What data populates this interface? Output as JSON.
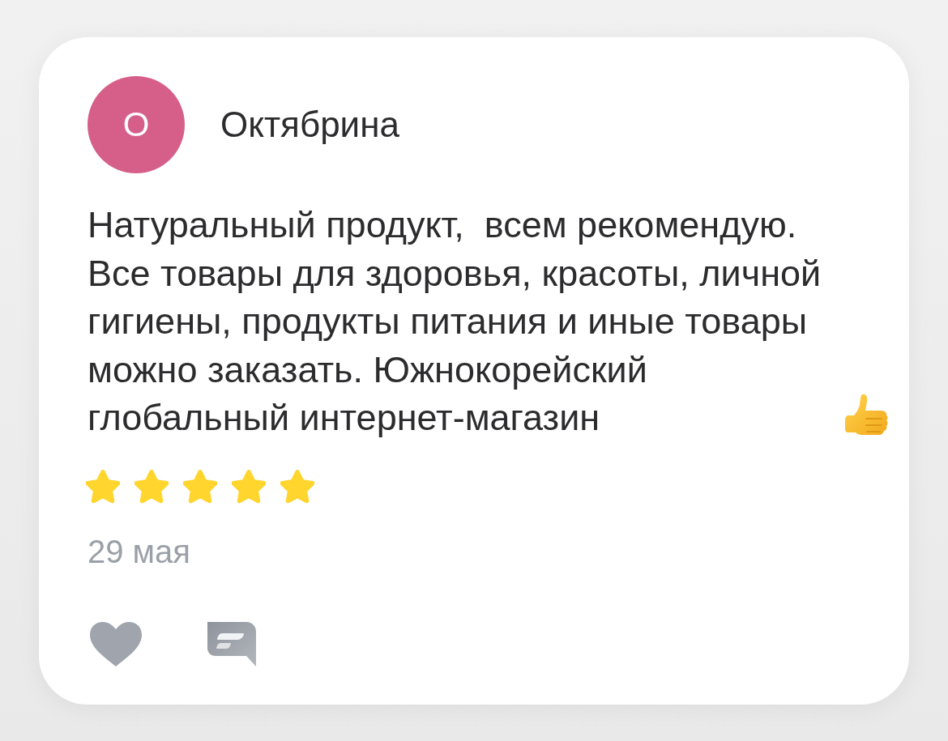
{
  "review": {
    "avatar_initial": "О",
    "author": "Октябрина",
    "text": "Натуральный продукт,  всем рекомендую. Все товары для здоровья, красоты, личной гигиены, продукты питания и иные товары можно заказать. Южнокорейский глобальный интернет-магазин",
    "stars": 5,
    "date": "29 мая",
    "liked": false
  }
}
